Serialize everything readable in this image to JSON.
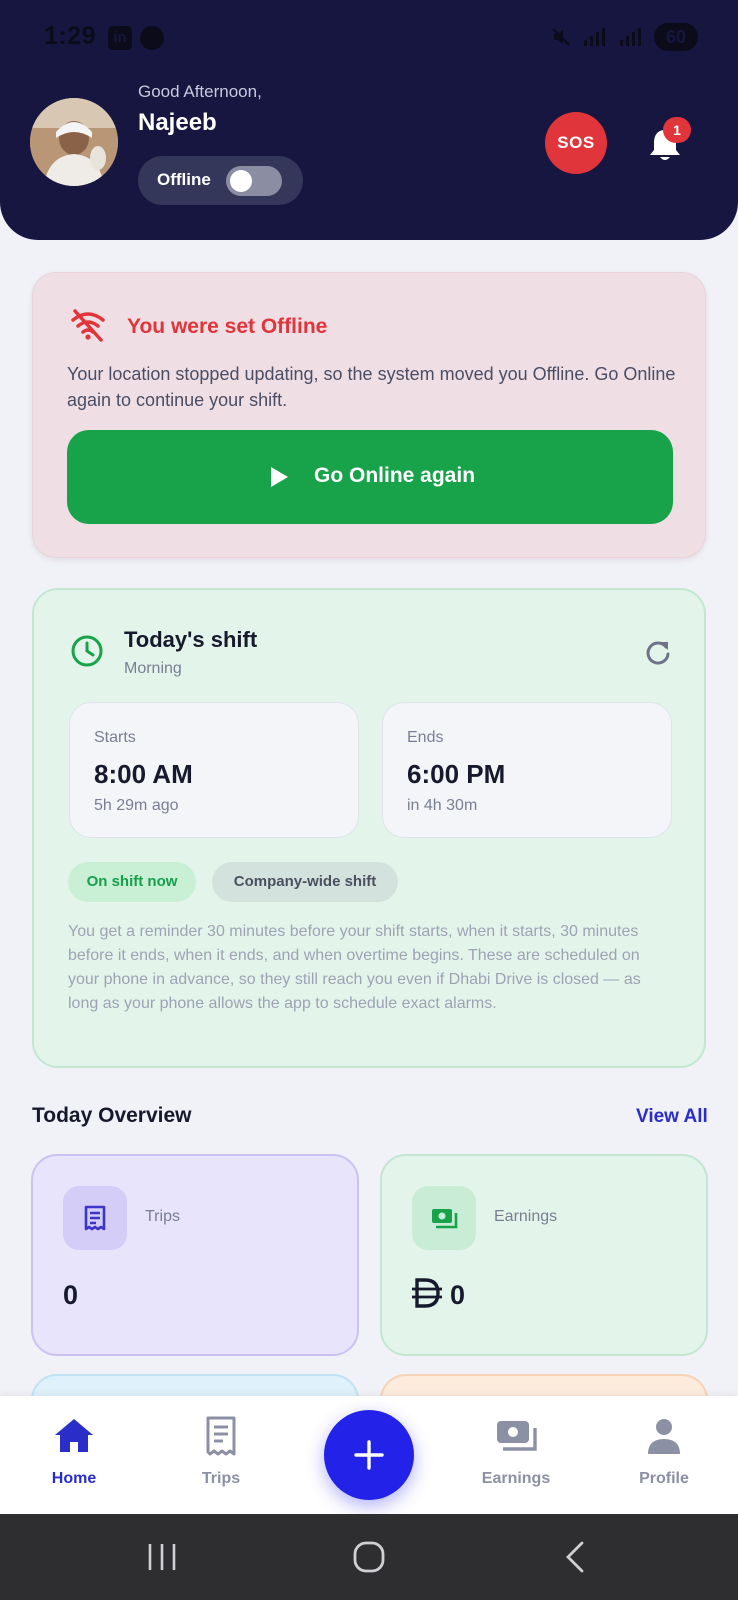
{
  "status_bar": {
    "time": "1:29",
    "battery": "60"
  },
  "header": {
    "greeting": "Good Afternoon,",
    "name": "Najeeb",
    "status_label": "Offline",
    "sos_label": "SOS",
    "notification_count": "1"
  },
  "offline_alert": {
    "title": "You were set Offline",
    "description": "Your location stopped updating, so the system moved you Offline. Go Online again to continue your shift.",
    "button_label": "Go Online again"
  },
  "shift": {
    "title": "Today's shift",
    "subtitle": "Morning",
    "starts": {
      "label": "Starts",
      "time": "8:00 AM",
      "relative": "5h 29m ago"
    },
    "ends": {
      "label": "Ends",
      "time": "6:00 PM",
      "relative": "in 4h 30m"
    },
    "chips": [
      "On shift now",
      "Company-wide shift"
    ],
    "note": "You get a reminder 30 minutes before your shift starts, when it starts, 30 minutes before it ends, when it ends, and when overtime begins. These are scheduled on your phone in advance, so they still reach you even if Dhabi Drive is closed — as long as your phone allows the app to schedule exact alarms."
  },
  "overview": {
    "title": "Today Overview",
    "view_all": "View All",
    "cards": [
      {
        "label": "Trips",
        "value": "0"
      },
      {
        "label": "Earnings",
        "value": "0"
      }
    ]
  },
  "bottom_nav": {
    "items": [
      {
        "label": "Home"
      },
      {
        "label": "Trips"
      },
      {
        "label": "Earnings"
      },
      {
        "label": "Profile"
      }
    ]
  },
  "colors": {
    "header_bg": "#161640",
    "accent_blue": "#2222e8",
    "success_green": "#18a34a",
    "alert_red": "#e0353b"
  }
}
